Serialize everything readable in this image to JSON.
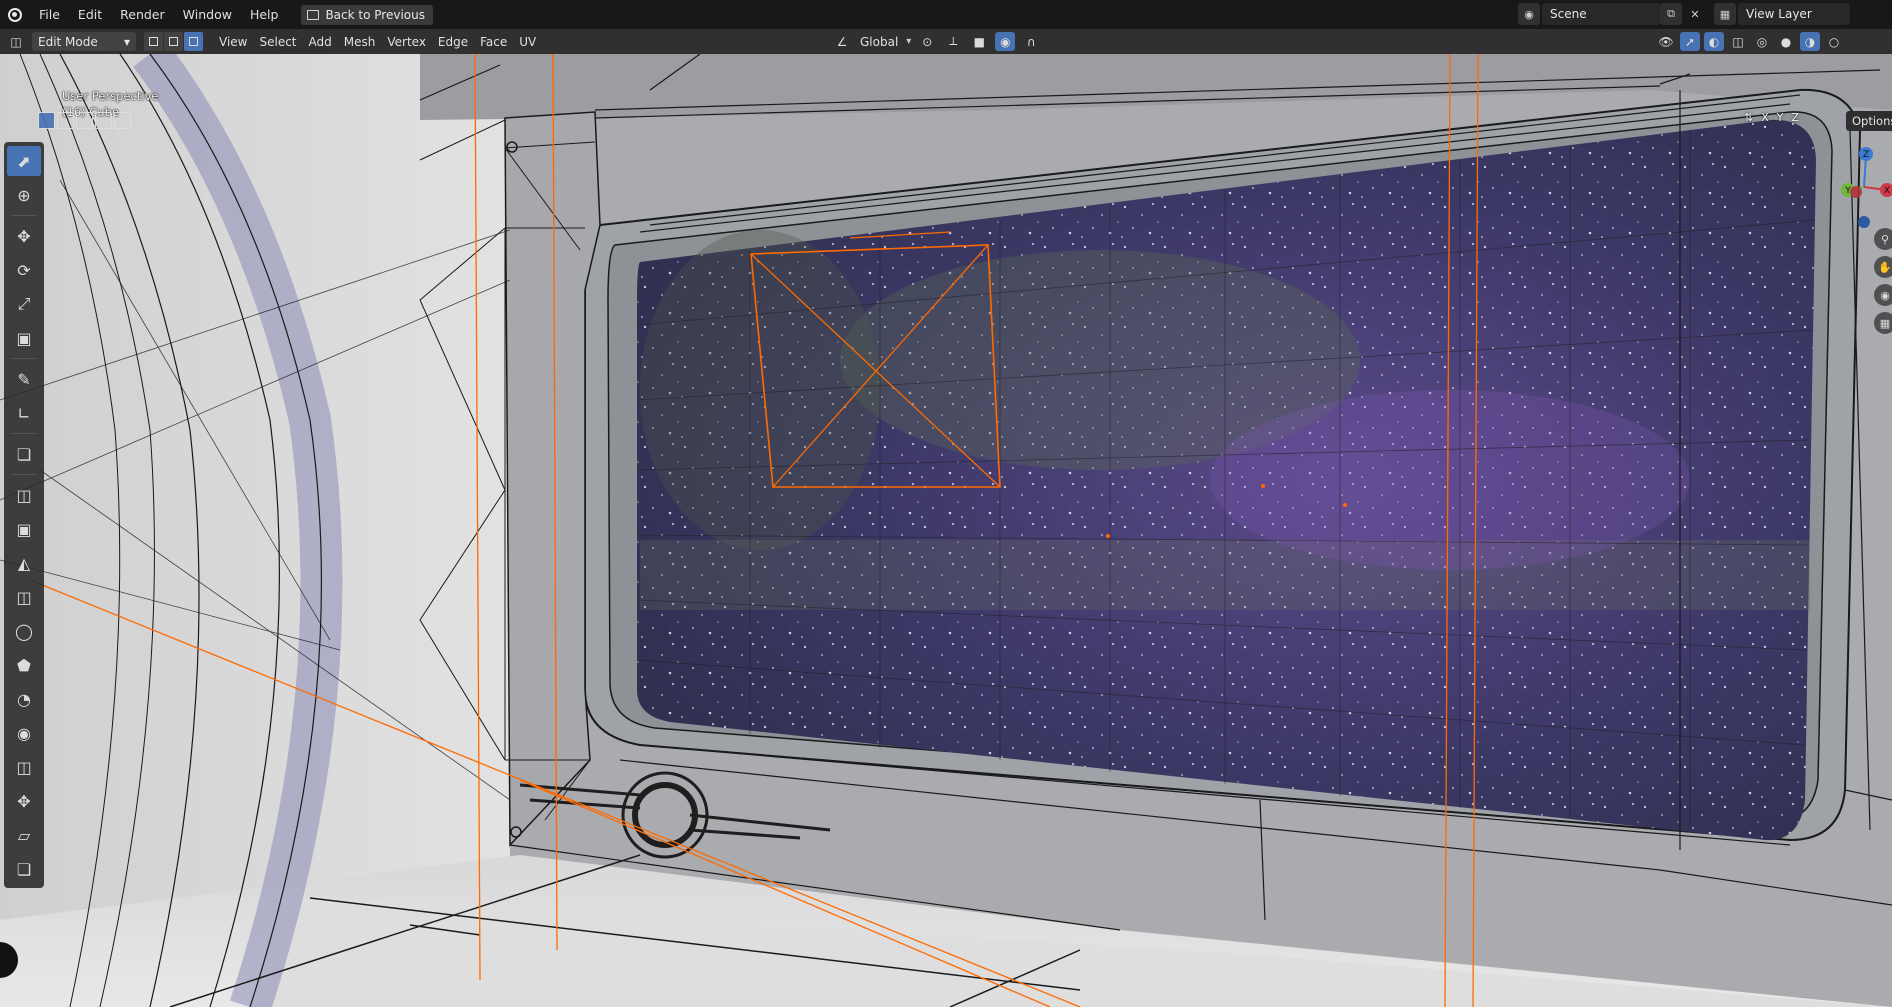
{
  "topbar": {
    "menus": [
      "File",
      "Edit",
      "Render",
      "Window",
      "Help"
    ],
    "back_button": "Back to Previous",
    "scene": "Scene",
    "view_layer": "View Layer"
  },
  "header": {
    "mode": "Edit Mode",
    "menus": [
      "View",
      "Select",
      "Add",
      "Mesh",
      "Vertex",
      "Edge",
      "Face",
      "UV"
    ],
    "transform_orientation": "Global"
  },
  "viewport": {
    "perspective": "User Perspective",
    "object": "(16) Cube",
    "axes": [
      "X",
      "Y",
      "Z"
    ],
    "options": "Options",
    "gizmo_labels": [
      "Z",
      "Y",
      "X"
    ]
  },
  "toolbar": {
    "tools": [
      "select-box",
      "cursor",
      "move",
      "rotate",
      "scale",
      "transform",
      "annotate",
      "measure",
      "add-cube",
      "extrude-region",
      "inset-faces",
      "bevel",
      "loop-cut",
      "knife",
      "poly-build",
      "spin",
      "smooth",
      "edge-slide",
      "shrink-fatten",
      "shear",
      "rip-region"
    ]
  },
  "colors": {
    "accent": "#4772b3",
    "selection": "#ff6a00",
    "wire": "#1a1a1a"
  }
}
